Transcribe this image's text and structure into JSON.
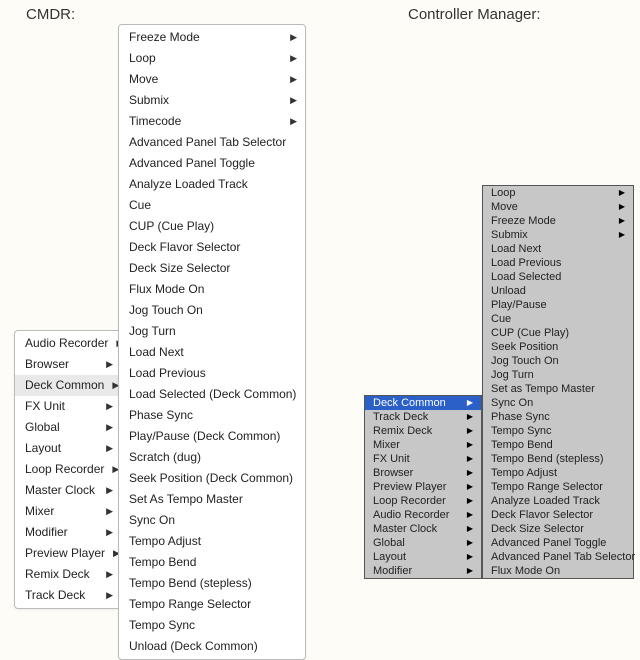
{
  "left": {
    "title": "CMDR:",
    "categories": [
      {
        "label": "Audio Recorder",
        "hasSub": true
      },
      {
        "label": "Browser",
        "hasSub": true
      },
      {
        "label": "Deck Common",
        "hasSub": true,
        "highlight": true
      },
      {
        "label": "FX Unit",
        "hasSub": true
      },
      {
        "label": "Global",
        "hasSub": true
      },
      {
        "label": "Layout",
        "hasSub": true
      },
      {
        "label": "Loop Recorder",
        "hasSub": true
      },
      {
        "label": "Master Clock",
        "hasSub": true
      },
      {
        "label": "Mixer",
        "hasSub": true
      },
      {
        "label": "Modifier",
        "hasSub": true
      },
      {
        "label": "Preview Player",
        "hasSub": true
      },
      {
        "label": "Remix Deck",
        "hasSub": true
      },
      {
        "label": "Track Deck",
        "hasSub": true
      }
    ],
    "submenu": [
      {
        "label": "Freeze Mode",
        "hasSub": true
      },
      {
        "label": "Loop",
        "hasSub": true
      },
      {
        "label": "Move",
        "hasSub": true
      },
      {
        "label": "Submix",
        "hasSub": true
      },
      {
        "label": "Timecode",
        "hasSub": true
      },
      {
        "label": "Advanced Panel Tab Selector"
      },
      {
        "label": "Advanced Panel Toggle"
      },
      {
        "label": "Analyze Loaded Track"
      },
      {
        "label": "Cue"
      },
      {
        "label": "CUP (Cue Play)"
      },
      {
        "label": "Deck Flavor Selector"
      },
      {
        "label": "Deck Size Selector"
      },
      {
        "label": "Flux Mode On"
      },
      {
        "label": "Jog Touch On"
      },
      {
        "label": "Jog Turn"
      },
      {
        "label": "Load Next"
      },
      {
        "label": "Load Previous"
      },
      {
        "label": "Load Selected (Deck Common)"
      },
      {
        "label": "Phase Sync"
      },
      {
        "label": "Play/Pause (Deck Common)"
      },
      {
        "label": "Scratch (dug)"
      },
      {
        "label": "Seek Position (Deck Common)"
      },
      {
        "label": "Set As Tempo Master"
      },
      {
        "label": "Sync On"
      },
      {
        "label": "Tempo Adjust"
      },
      {
        "label": "Tempo Bend"
      },
      {
        "label": "Tempo Bend (stepless)"
      },
      {
        "label": "Tempo Range Selector"
      },
      {
        "label": "Tempo Sync"
      },
      {
        "label": "Unload (Deck Common)"
      }
    ]
  },
  "right": {
    "title": "Controller Manager:",
    "categories": [
      {
        "label": "Deck Common",
        "hasSub": true,
        "highlight": true
      },
      {
        "label": "Track Deck",
        "hasSub": true
      },
      {
        "label": "Remix Deck",
        "hasSub": true
      },
      {
        "label": "Mixer",
        "hasSub": true
      },
      {
        "label": "FX Unit",
        "hasSub": true
      },
      {
        "label": "Browser",
        "hasSub": true
      },
      {
        "label": "Preview Player",
        "hasSub": true
      },
      {
        "label": "Loop Recorder",
        "hasSub": true
      },
      {
        "label": "Audio Recorder",
        "hasSub": true
      },
      {
        "label": "Master Clock",
        "hasSub": true
      },
      {
        "label": "Global",
        "hasSub": true
      },
      {
        "label": "Layout",
        "hasSub": true
      },
      {
        "label": "Modifier",
        "hasSub": true
      }
    ],
    "submenu": [
      {
        "label": "Loop",
        "hasSub": true
      },
      {
        "label": "Move",
        "hasSub": true
      },
      {
        "label": "Freeze Mode",
        "hasSub": true
      },
      {
        "label": "Submix",
        "hasSub": true
      },
      {
        "label": "Load Next"
      },
      {
        "label": "Load Previous"
      },
      {
        "label": "Load Selected"
      },
      {
        "label": "Unload"
      },
      {
        "label": "Play/Pause"
      },
      {
        "label": "Cue"
      },
      {
        "label": "CUP (Cue Play)"
      },
      {
        "label": "Seek Position"
      },
      {
        "label": "Jog Touch On"
      },
      {
        "label": "Jog Turn"
      },
      {
        "label": "Set as Tempo Master"
      },
      {
        "label": "Sync On"
      },
      {
        "label": "Phase Sync"
      },
      {
        "label": "Tempo Sync"
      },
      {
        "label": "Tempo Bend"
      },
      {
        "label": "Tempo Bend (stepless)"
      },
      {
        "label": "Tempo Adjust"
      },
      {
        "label": "Tempo Range Selector"
      },
      {
        "label": "Analyze Loaded Track"
      },
      {
        "label": "Deck Flavor Selector"
      },
      {
        "label": "Deck Size Selector"
      },
      {
        "label": "Advanced Panel Toggle"
      },
      {
        "label": "Advanced Panel Tab Selector"
      },
      {
        "label": "Flux Mode On"
      }
    ]
  }
}
